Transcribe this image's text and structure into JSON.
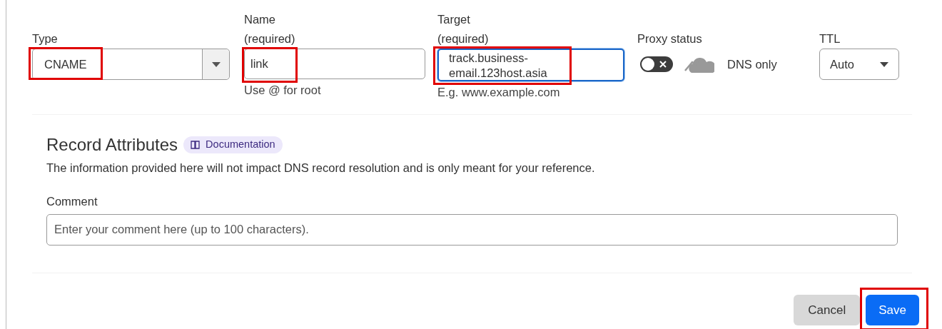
{
  "fields": [
    {
      "kind": "select",
      "label": "Type",
      "value": "CNAME",
      "highlighted": true
    },
    {
      "kind": "text",
      "label": "Name",
      "required": "(required)",
      "value": "link",
      "hint": "Use @ for root",
      "highlighted": true
    },
    {
      "kind": "textarea",
      "label": "Target",
      "required": "(required)",
      "value": "track.business-email.123host.asia",
      "hint": "E.g. www.example.com",
      "focused": true,
      "highlighted": true
    },
    {
      "kind": "proxy",
      "label": "Proxy status",
      "on": false,
      "status": "DNS only"
    },
    {
      "kind": "small-select",
      "label": "TTL",
      "value": "Auto"
    }
  ],
  "attributes": {
    "title": "Record Attributes",
    "doc_link": "Documentation",
    "description": "The information provided here will not impact DNS record resolution and is only meant for your reference.",
    "comment_label": "Comment",
    "comment_placeholder": "Enter your comment here (up to 100 characters)."
  },
  "buttons": [
    {
      "kind": "secondary",
      "label": "Cancel",
      "highlighted": false
    },
    {
      "kind": "primary",
      "label": "Save",
      "highlighted": true
    }
  ]
}
